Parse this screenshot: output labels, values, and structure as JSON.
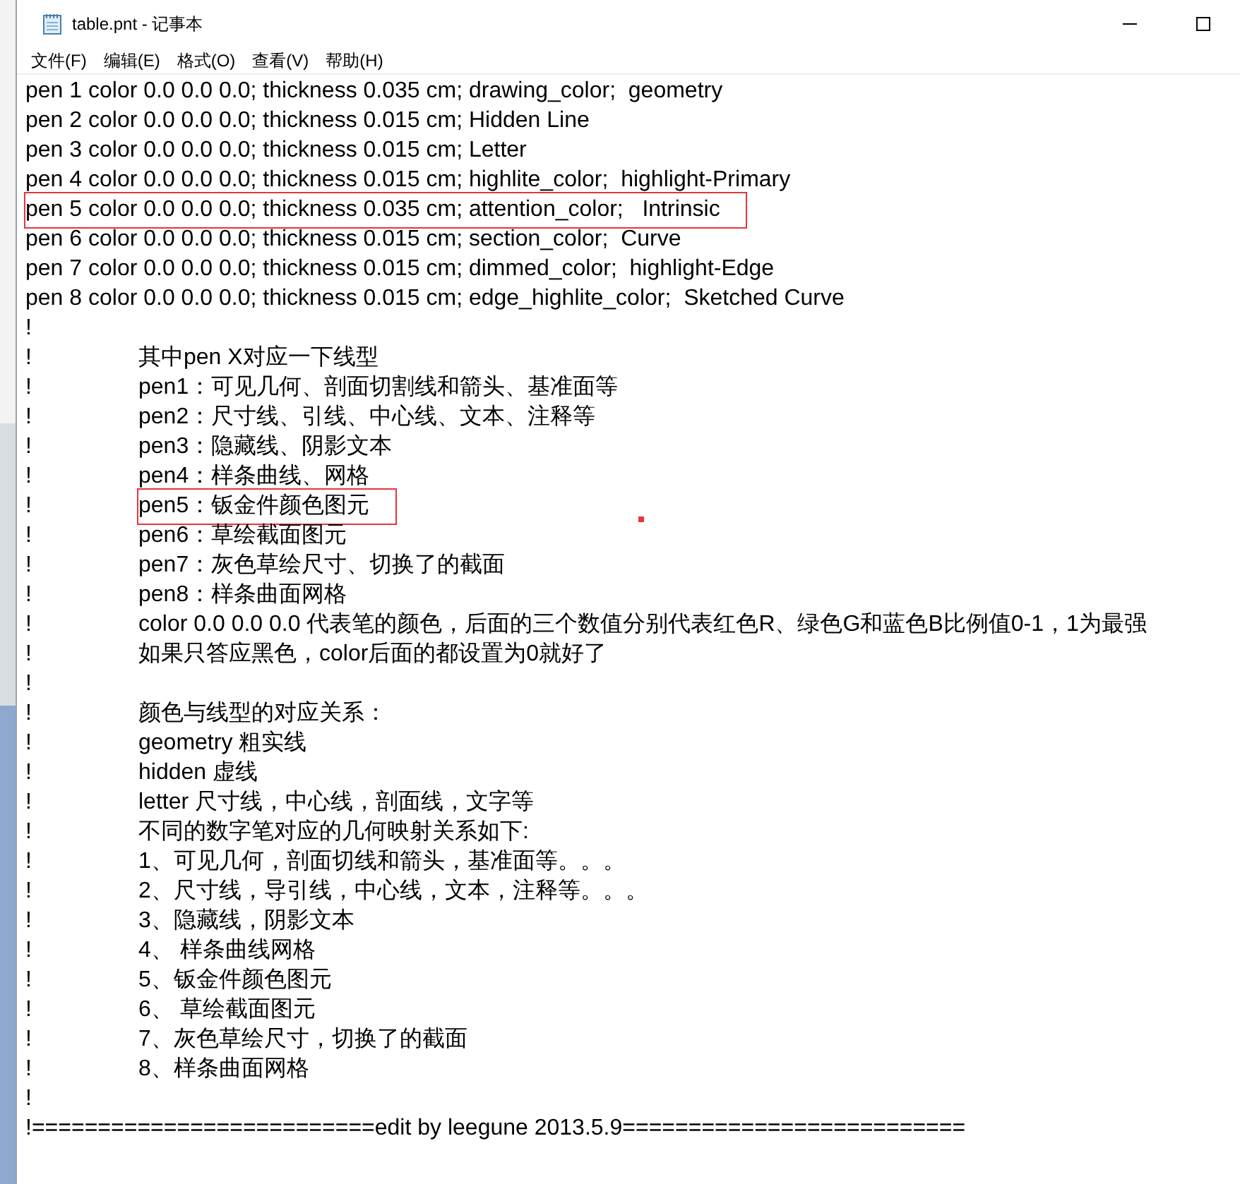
{
  "window": {
    "title": "table.pnt - 记事本"
  },
  "menu": [
    "文件(F)",
    "编辑(E)",
    "格式(O)",
    "查看(V)",
    "帮助(H)"
  ],
  "editor": {
    "stray_dot": true,
    "lines": [
      {
        "kind": "code",
        "text": "pen 1 color 0.0 0.0 0.0; thickness 0.035 cm; drawing_color;  geometry",
        "highlighted": false
      },
      {
        "kind": "code",
        "text": "pen 2 color 0.0 0.0 0.0; thickness 0.015 cm; Hidden Line",
        "highlighted": false
      },
      {
        "kind": "code",
        "text": "pen 3 color 0.0 0.0 0.0; thickness 0.015 cm; Letter",
        "highlighted": false
      },
      {
        "kind": "code",
        "text": "pen 4 color 0.0 0.0 0.0; thickness 0.015 cm; highlite_color;  highlight-Primary",
        "highlighted": false
      },
      {
        "kind": "code",
        "text": "pen 5 color 0.0 0.0 0.0; thickness 0.035 cm; attention_color;   Intrinsic",
        "highlighted": true
      },
      {
        "kind": "code",
        "text": "pen 6 color 0.0 0.0 0.0; thickness 0.015 cm; section_color;  Curve",
        "highlighted": false
      },
      {
        "kind": "code",
        "text": "pen 7 color 0.0 0.0 0.0; thickness 0.015 cm; dimmed_color;  highlight-Edge",
        "highlighted": false
      },
      {
        "kind": "code",
        "text": "pen 8 color 0.0 0.0 0.0; thickness 0.015 cm; edge_highlite_color;  Sketched Curve",
        "highlighted": false
      },
      {
        "kind": "note",
        "marker": "!",
        "highlighted": false
      },
      {
        "kind": "note",
        "marker": "!",
        "text": "其中pen X对应一下线型",
        "highlighted": false
      },
      {
        "kind": "note",
        "marker": "!",
        "text": "pen1：可见几何、剖面切割线和箭头、基准面等",
        "highlighted": false
      },
      {
        "kind": "note",
        "marker": "!",
        "text": "pen2：尺寸线、引线、中心线、文本、注释等",
        "highlighted": false
      },
      {
        "kind": "note",
        "marker": "!",
        "text": "pen3：隐藏线、阴影文本",
        "highlighted": false
      },
      {
        "kind": "note",
        "marker": "!",
        "text": "pen4：样条曲线、网格",
        "highlighted": false
      },
      {
        "kind": "note",
        "marker": "!",
        "text": "pen5：钣金件颜色图元",
        "highlighted": true
      },
      {
        "kind": "note",
        "marker": "!",
        "text": "pen6：草绘截面图元",
        "highlighted": false
      },
      {
        "kind": "note",
        "marker": "!",
        "text": "pen7：灰色草绘尺寸、切换了的截面",
        "highlighted": false
      },
      {
        "kind": "note",
        "marker": "!",
        "text": "pen8：样条曲面网格",
        "highlighted": false
      },
      {
        "kind": "note",
        "marker": "!",
        "text": "color 0.0 0.0 0.0 代表笔的颜色，后面的三个数值分别代表红色R、绿色G和蓝色B比例值0-1，1为最强",
        "highlighted": false
      },
      {
        "kind": "note",
        "marker": "!",
        "text": "如果只答应黑色，color后面的都设置为0就好了",
        "highlighted": false
      },
      {
        "kind": "note",
        "marker": "!",
        "highlighted": false
      },
      {
        "kind": "note",
        "marker": "!",
        "text": "颜色与线型的对应关系：",
        "highlighted": false
      },
      {
        "kind": "note",
        "marker": "!",
        "text": "geometry 粗实线",
        "highlighted": false
      },
      {
        "kind": "note",
        "marker": "!",
        "text": "hidden 虚线",
        "highlighted": false
      },
      {
        "kind": "note",
        "marker": "!",
        "text": "letter 尺寸线，中心线，剖面线，文字等",
        "highlighted": false
      },
      {
        "kind": "note",
        "marker": "!",
        "text": "不同的数字笔对应的几何映射关系如下:",
        "highlighted": false
      },
      {
        "kind": "note",
        "marker": "!",
        "text": "1、可见几何，剖面切线和箭头，基准面等。。。",
        "highlighted": false
      },
      {
        "kind": "note",
        "marker": "!",
        "text": "2、尺寸线，导引线，中心线，文本，注释等。。。",
        "highlighted": false
      },
      {
        "kind": "note",
        "marker": "!",
        "text": "3、隐藏线，阴影文本",
        "highlighted": false
      },
      {
        "kind": "note",
        "marker": "!",
        "text": "4、 样条曲线网格",
        "highlighted": false
      },
      {
        "kind": "note",
        "marker": "!",
        "text": "5、钣金件颜色图元",
        "highlighted": false
      },
      {
        "kind": "note",
        "marker": "!",
        "text": "6、 草绘截面图元",
        "highlighted": false
      },
      {
        "kind": "note",
        "marker": "!",
        "text": "7、灰色草绘尺寸，切换了的截面",
        "highlighted": false
      },
      {
        "kind": "note",
        "marker": "!",
        "text": "8、样条曲面网格",
        "highlighted": false
      },
      {
        "kind": "note",
        "marker": "!",
        "highlighted": false
      },
      {
        "kind": "code",
        "text": "!==========================edit by leegune 2013.5.9==========================",
        "highlighted": false
      }
    ]
  }
}
